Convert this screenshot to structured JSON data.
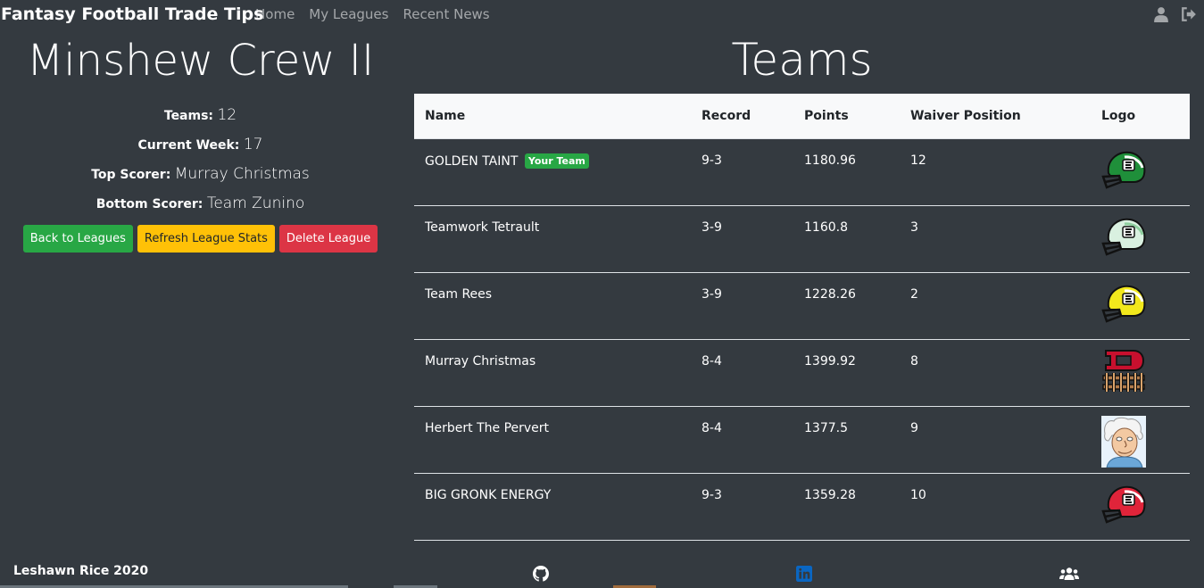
{
  "navbar": {
    "brand": "Fantasy Football Trade Tips",
    "links": [
      "Home",
      "My Leagues",
      "Recent News"
    ],
    "icons": [
      "user-icon",
      "sign-out-icon"
    ]
  },
  "league": {
    "name": "Minshew Crew II",
    "stats": [
      {
        "label": "Teams:",
        "value": "12"
      },
      {
        "label": "Current Week:",
        "value": "17"
      },
      {
        "label": "Top Scorer:",
        "value": "Murray Christmas"
      },
      {
        "label": "Bottom Scorer:",
        "value": "Team Zunino"
      }
    ],
    "buttons": {
      "back": "Back to Leagues",
      "refresh": "Refresh League Stats",
      "delete": "Delete League"
    }
  },
  "teams": {
    "title": "Teams",
    "headers": [
      "Name",
      "Record",
      "Points",
      "Waiver Position",
      "Logo"
    ],
    "your_team_badge": "Your Team",
    "rows": [
      {
        "name": "GOLDEN TAINT",
        "is_yours": true,
        "record": "9-3",
        "points": "1180.96",
        "waiver": "12",
        "logo": "helmet-green-icon"
      },
      {
        "name": "Teamwork Tetrault",
        "is_yours": false,
        "record": "3-9",
        "points": "1160.8",
        "waiver": "3",
        "logo": "helmet-pale-green-icon"
      },
      {
        "name": "Team Rees",
        "is_yours": false,
        "record": "3-9",
        "points": "1228.26",
        "waiver": "2",
        "logo": "helmet-yellow-icon"
      },
      {
        "name": "Murray Christmas",
        "is_yours": false,
        "record": "8-4",
        "points": "1399.92",
        "waiver": "8",
        "logo": "d-fence-logo-icon"
      },
      {
        "name": "Herbert The Pervert",
        "is_yours": false,
        "record": "8-4",
        "points": "1377.5",
        "waiver": "9",
        "logo": "old-man-avatar-icon"
      },
      {
        "name": "BIG GRONK ENERGY",
        "is_yours": false,
        "record": "9-3",
        "points": "1359.28",
        "waiver": "10",
        "logo": "helmet-red-icon"
      }
    ]
  },
  "footer": {
    "text": "Leshawn Rice 2020",
    "icons": [
      "github-icon",
      "linkedin-icon",
      "users-icon"
    ]
  },
  "colors": {
    "background": "#343a40",
    "success": "#28a745",
    "warning": "#ffc107",
    "danger": "#dc3545",
    "linkedin": "#0a66c2"
  }
}
